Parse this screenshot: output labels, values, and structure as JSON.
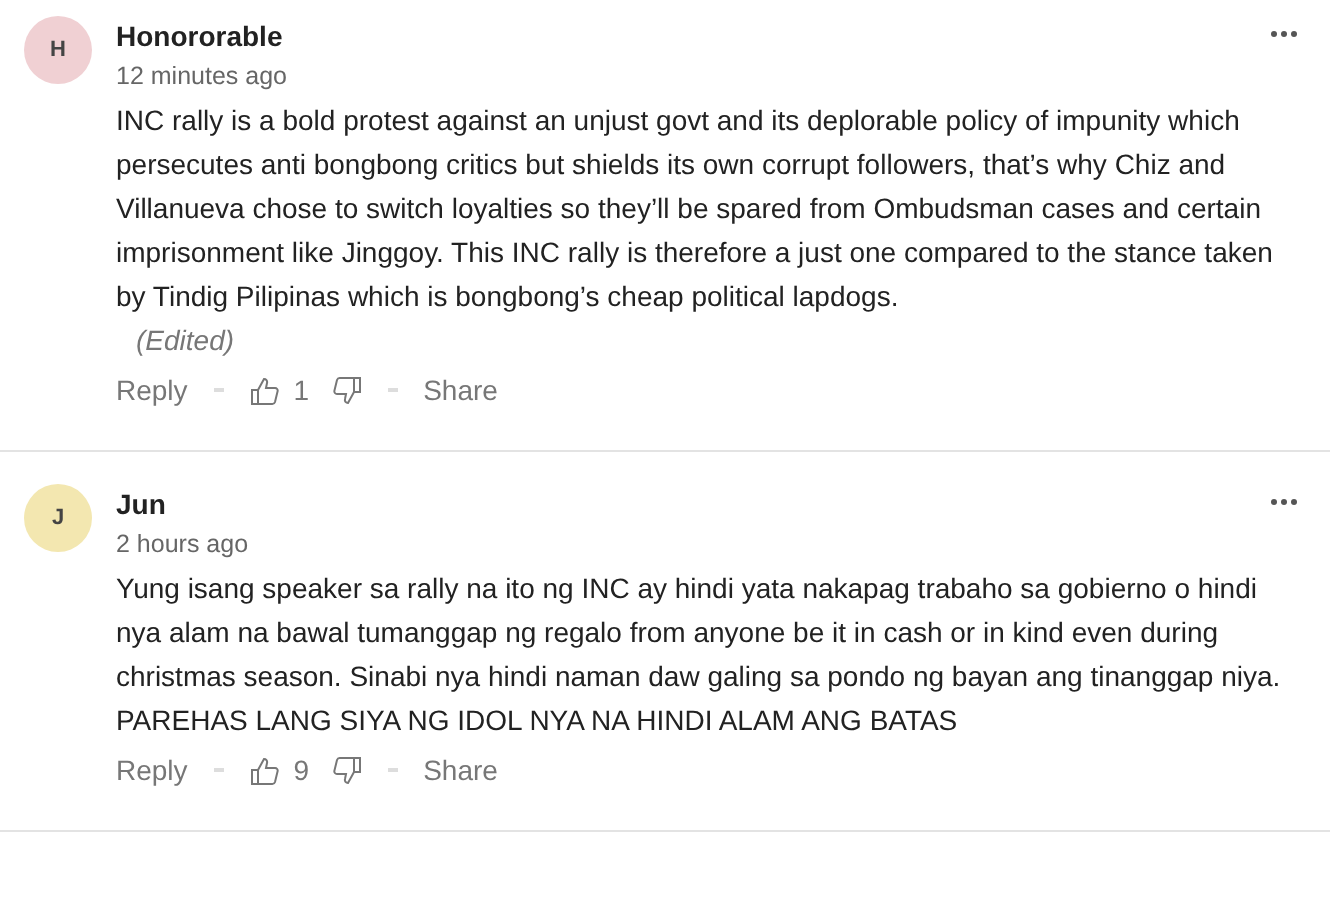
{
  "comments": [
    {
      "initial": "H",
      "color": "#f0d0d3",
      "author": "Honororable",
      "time": "12 minutes ago",
      "body": "INC rally is a bold protest against an unjust govt and its deplorable policy of impunity which persecutes anti bongbong critics but shields its own corrupt followers, that’s why Chiz and Villanueva chose to switch loyalties so they’ll be spared from Ombudsman cases and certain imprisonment like Jinggoy. This INC rally is therefore a just one compared to the stance taken by Tindig Pilipinas which is bongbong’s cheap political lapdogs.",
      "edited": "(Edited)",
      "reply": "Reply",
      "likes": "1",
      "share": "Share"
    },
    {
      "initial": "J",
      "color": "#f3e7b0",
      "author": "Jun",
      "time": "2 hours ago",
      "body": "Yung isang speaker sa rally na ito ng INC ay hindi yata nakapag trabaho sa gobierno o hindi nya alam na bawal tumanggap ng regalo from anyone be it in cash or in kind even during christmas season. Sinabi nya hindi naman daw galing sa pondo ng bayan ang tinanggap niya. PAREHAS LANG SIYA NG IDOL NYA NA HINDI ALAM ANG BATAS",
      "reply": "Reply",
      "likes": "9",
      "share": "Share"
    }
  ]
}
